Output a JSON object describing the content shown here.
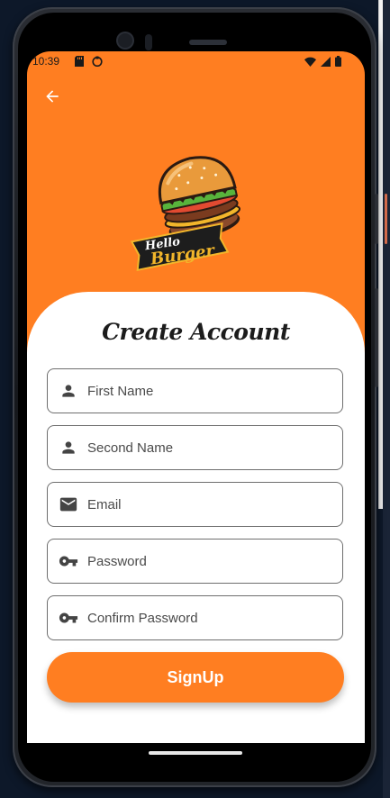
{
  "status_bar": {
    "time": "10:39",
    "left_icons": [
      "sd-card-icon",
      "app-status-icon"
    ],
    "right_icons": [
      "wifi-icon",
      "signal-icon",
      "battery-icon"
    ]
  },
  "header": {
    "back_icon": "arrow-back-icon",
    "logo": {
      "line1": "Hello",
      "line2": "Burger"
    }
  },
  "form": {
    "title": "Create Account",
    "fields": [
      {
        "placeholder": "First Name",
        "value": "",
        "icon": "person-icon"
      },
      {
        "placeholder": "Second Name",
        "value": "",
        "icon": "person-icon"
      },
      {
        "placeholder": "Email",
        "value": "",
        "icon": "mail-icon"
      },
      {
        "placeholder": "Password",
        "value": "",
        "icon": "key-icon"
      },
      {
        "placeholder": "Confirm Password",
        "value": "",
        "icon": "key-icon"
      }
    ],
    "submit_label": "SignUp"
  },
  "colors": {
    "accent": "#ff7e21",
    "card": "#ffffff",
    "text": "#1c1c1c"
  }
}
